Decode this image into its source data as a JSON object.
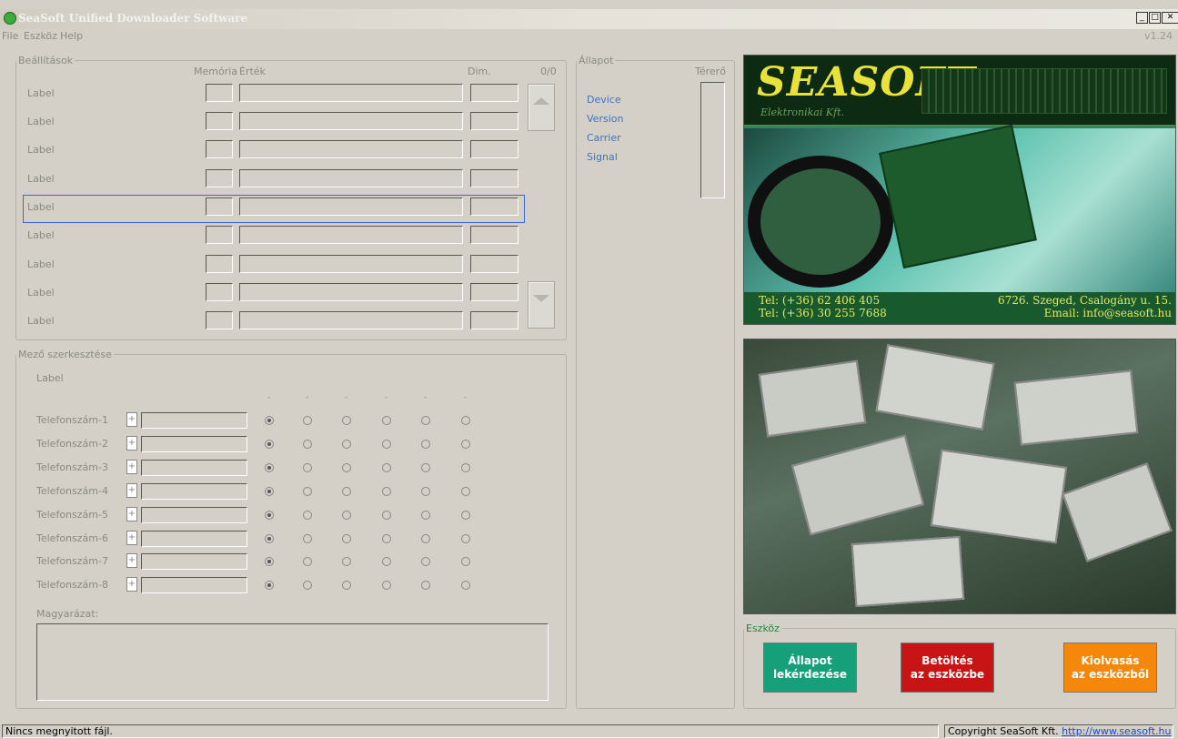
{
  "window": {
    "title": "SeaSoft Unified Downloader Software",
    "version": "v1.24"
  },
  "menu": [
    "File",
    "Eszköz",
    "Help"
  ],
  "settings": {
    "legend": "Beállítások",
    "col_memory": "Memória",
    "col_value": "Érték",
    "col_dim": "Dim.",
    "counter": "0/0",
    "rows": [
      "Label",
      "Label",
      "Label",
      "Label",
      "Label",
      "Label",
      "Label",
      "Label",
      "Label"
    ],
    "selected_row": 5
  },
  "status": {
    "legend": "Állapot",
    "signal_col": "Térerő",
    "items": [
      "Device",
      "Version",
      "Carrier",
      "Signal"
    ]
  },
  "edit": {
    "legend": "Mező szerkesztése",
    "field_label": "Label",
    "col_headers": [
      "-",
      "-",
      "-",
      "-",
      "-",
      "-"
    ],
    "rows": [
      "Telefonszám-1",
      "Telefonszám-2",
      "Telefonszám-3",
      "Telefonszám-4",
      "Telefonszám-5",
      "Telefonszám-6",
      "Telefonszám-7",
      "Telefonszám-8"
    ],
    "plus": "+",
    "note_label": "Magyarázat:"
  },
  "banner": {
    "logo": "SEASOFT",
    "tagline": "Elektronikai Kft.",
    "tel1": "Tel: (+36) 62 406 405",
    "tel2": "Tel: (+36) 30 255 7688",
    "address": "6726. Szeged, Csalogány u. 15.",
    "email": "Email:  info@seasoft.hu"
  },
  "device": {
    "legend": "Eszköz",
    "buttons": [
      {
        "line1": "Állapot",
        "line2": "lekérdezése",
        "color": "#16a07a"
      },
      {
        "line1": "Betöltés",
        "line2": "az eszközbe",
        "color": "#c81414"
      },
      {
        "line1": "Kiolvasás",
        "line2": "az eszközből",
        "color": "#f5870a"
      }
    ]
  },
  "statusbar": {
    "left": "Nincs megnyitott fájl.",
    "copyright": "Copyright SeaSoft Kft.",
    "link": "http://www.seasoft.hu"
  },
  "icons": [
    "app-icon",
    "minimize-icon",
    "maximize-icon",
    "close-icon",
    "scroll-up-icon",
    "scroll-down-icon"
  ]
}
